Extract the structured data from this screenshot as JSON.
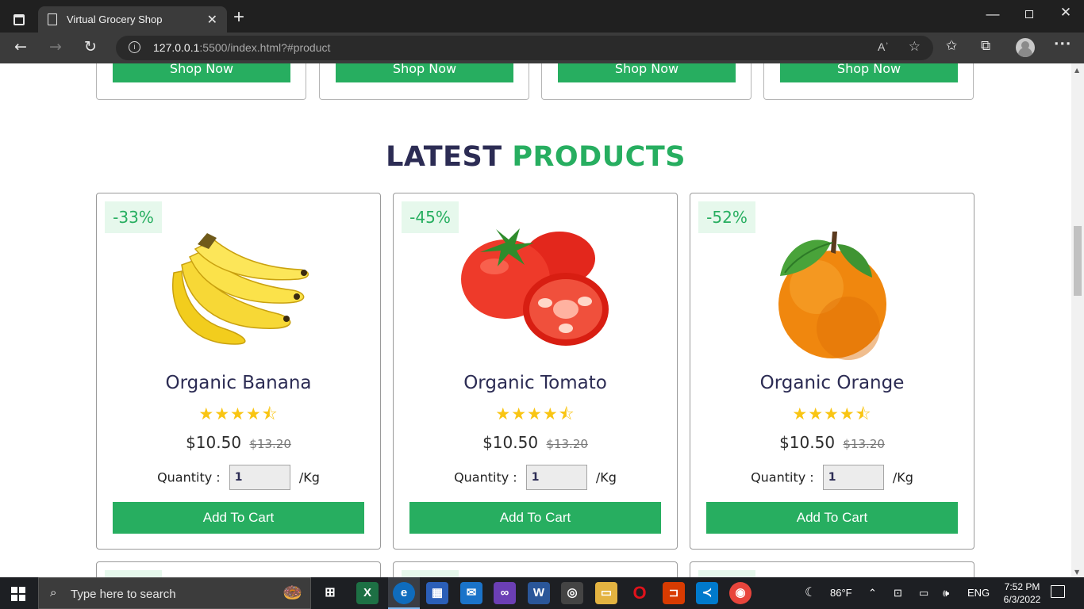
{
  "browser": {
    "tab_title": "Virtual Grocery Shop",
    "tab_close": "✕",
    "new_tab": "+",
    "url_host": "127.0.0.1",
    "url_rest": ":5500/index.html?#product",
    "read_aloud": "Aʾ"
  },
  "categories": {
    "button_label": "Shop Now"
  },
  "section": {
    "heading_part1": "LATEST",
    "heading_part2": "PRODUCTS"
  },
  "products": [
    {
      "discount": "-33%",
      "name": "Organic Banana",
      "stars": "★★★★⯪",
      "price": "$10.50",
      "old_price": "$13.20",
      "qty_label": "Quantity :",
      "qty_value": "1",
      "unit": "/Kg",
      "cart_label": "Add To Cart"
    },
    {
      "discount": "-45%",
      "name": "Organic Tomato",
      "stars": "★★★★⯪",
      "price": "$10.50",
      "old_price": "$13.20",
      "qty_label": "Quantity :",
      "qty_value": "1",
      "unit": "/Kg",
      "cart_label": "Add To Cart"
    },
    {
      "discount": "-52%",
      "name": "Organic Orange",
      "stars": "★★★★⯪",
      "price": "$10.50",
      "old_price": "$13.20",
      "qty_label": "Quantity :",
      "qty_value": "1",
      "unit": "/Kg",
      "cart_label": "Add To Cart"
    }
  ],
  "colors": {
    "accent": "#27ae60",
    "heading_dark": "#2c2c54",
    "star": "#f9c513",
    "discount_bg": "#e6f8ec"
  },
  "taskbar": {
    "search_placeholder": "Type here to search",
    "weather": "86°F",
    "language": "ENG",
    "time": "7:52 PM",
    "date": "6/3/2022"
  }
}
